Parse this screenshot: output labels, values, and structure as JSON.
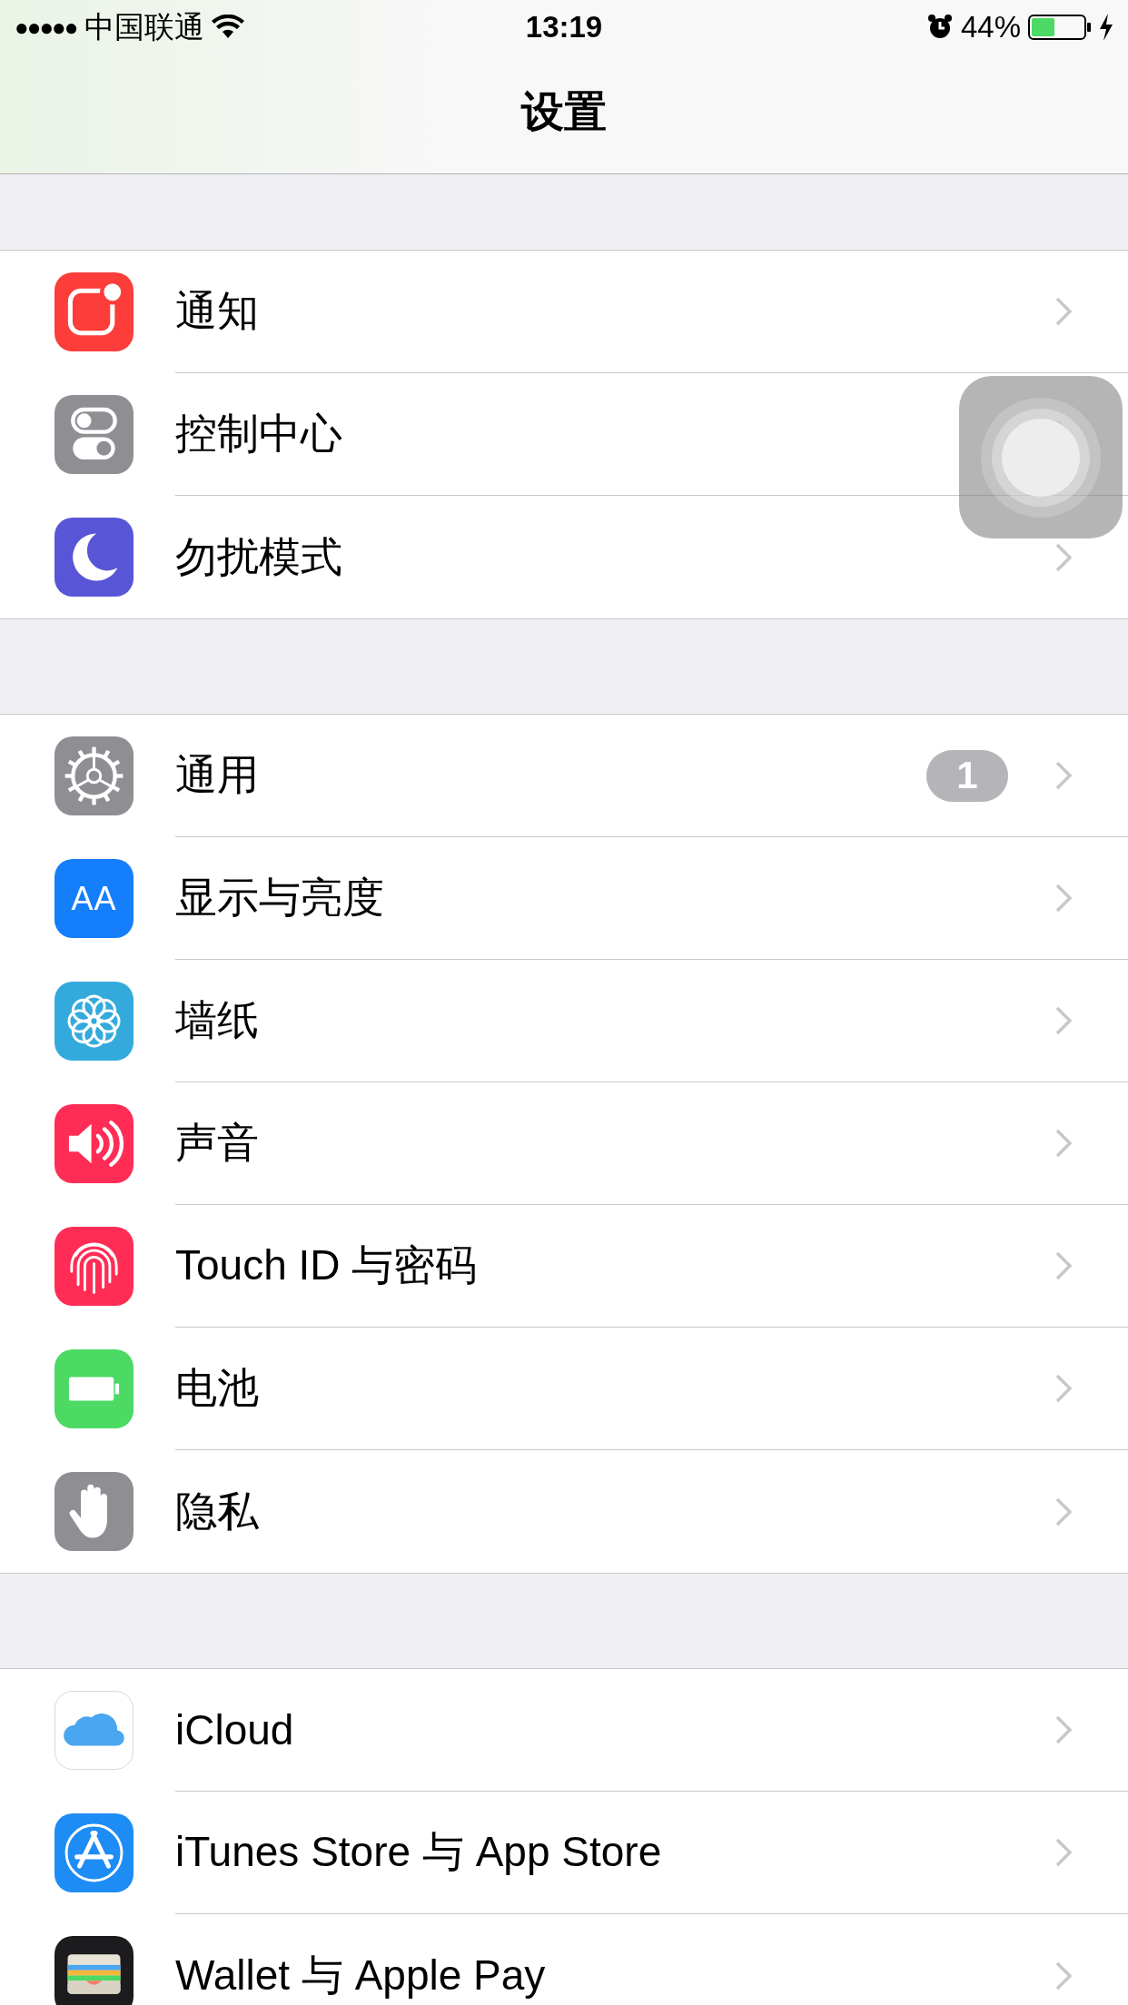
{
  "status_bar": {
    "signal_dots": "●●●●●",
    "carrier": "中国联通",
    "time": "13:19",
    "battery_percent": "44%",
    "charging": true
  },
  "nav": {
    "title": "设置"
  },
  "groups": [
    {
      "rows": [
        {
          "kind": "notifications",
          "label": "通知"
        },
        {
          "kind": "control-center",
          "label": "控制中心"
        },
        {
          "kind": "moon",
          "label": "勿扰模式"
        }
      ]
    },
    {
      "rows": [
        {
          "kind": "gear",
          "label": "通用",
          "badge": "1"
        },
        {
          "kind": "display",
          "icon_glyph": "AA",
          "label": "显示与亮度"
        },
        {
          "kind": "flower",
          "label": "墙纸"
        },
        {
          "kind": "speaker",
          "label": "声音"
        },
        {
          "kind": "fingerprint",
          "label": "Touch ID 与密码"
        },
        {
          "kind": "battery",
          "label": "电池"
        },
        {
          "kind": "hand",
          "label": "隐私"
        }
      ]
    },
    {
      "rows": [
        {
          "kind": "cloud",
          "label": "iCloud"
        },
        {
          "kind": "appstore",
          "label": "iTunes Store 与 App Store"
        },
        {
          "kind": "wallet",
          "label": "Wallet 与 Apple Pay"
        }
      ]
    }
  ],
  "assistive_touch": true
}
